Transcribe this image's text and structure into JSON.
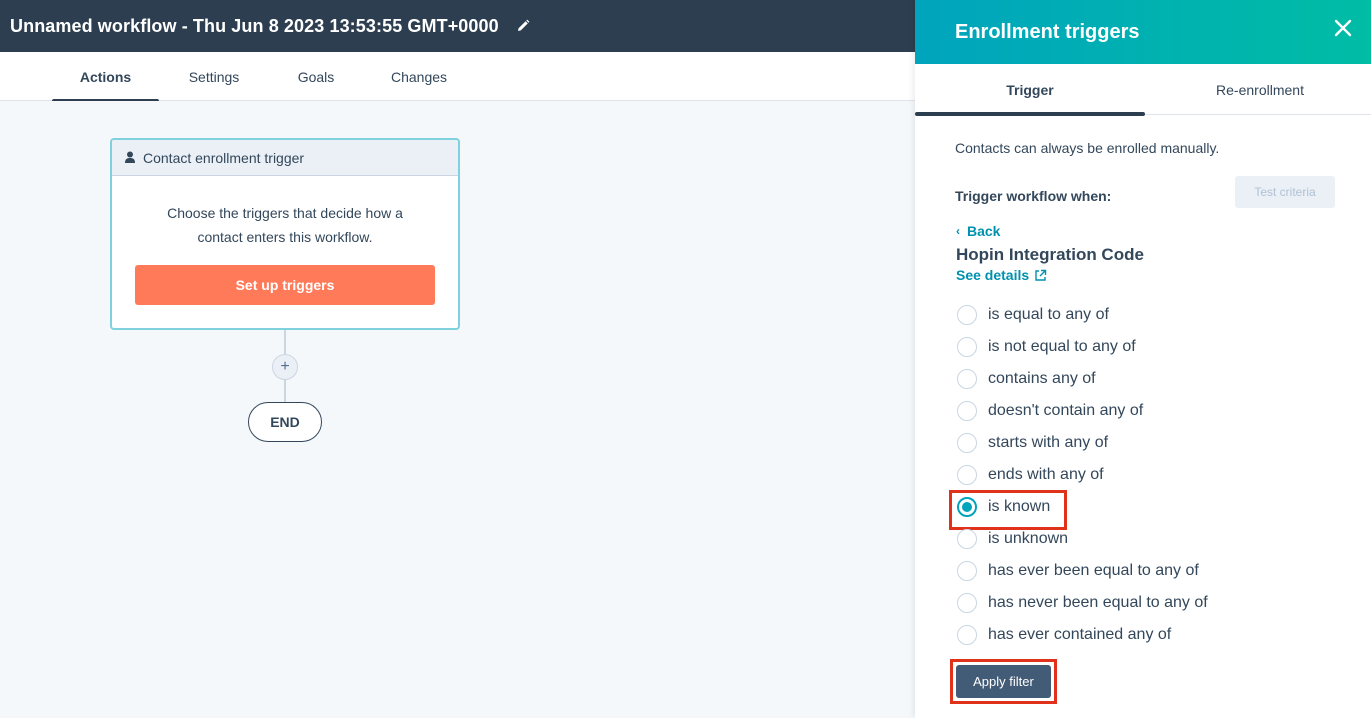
{
  "header": {
    "workflow_title": "Unnamed workflow - Thu Jun 8 2023 13:53:55 GMT+0000",
    "edit_icon": "pencil-icon"
  },
  "tabs": [
    {
      "label": "Actions",
      "active": true
    },
    {
      "label": "Settings",
      "active": false
    },
    {
      "label": "Goals",
      "active": false
    },
    {
      "label": "Changes",
      "active": false
    }
  ],
  "canvas": {
    "trigger_card": {
      "header_icon": "person-icon",
      "header": "Contact enrollment trigger",
      "body": "Choose the triggers that decide how a contact enters this workflow.",
      "button": "Set up triggers"
    },
    "add_action_symbol": "+",
    "end_label": "END"
  },
  "panel": {
    "title": "Enrollment triggers",
    "close_icon": "close-icon",
    "tabs": [
      {
        "label": "Trigger",
        "active": true
      },
      {
        "label": "Re-enrollment",
        "active": false
      }
    ],
    "manual_note": "Contacts can always be enrolled manually.",
    "trigger_when": "Trigger workflow when:",
    "test_criteria": "Test criteria",
    "back": "Back",
    "property_name": "Hopin Integration Code",
    "see_details": "See details",
    "options": [
      {
        "label": "is equal to any of",
        "selected": false
      },
      {
        "label": "is not equal to any of",
        "selected": false
      },
      {
        "label": "contains any of",
        "selected": false
      },
      {
        "label": "doesn't contain any of",
        "selected": false
      },
      {
        "label": "starts with any of",
        "selected": false
      },
      {
        "label": "ends with any of",
        "selected": false
      },
      {
        "label": "is known",
        "selected": true
      },
      {
        "label": "is unknown",
        "selected": false
      },
      {
        "label": "has ever been equal to any of",
        "selected": false
      },
      {
        "label": "has never been equal to any of",
        "selected": false
      },
      {
        "label": "has ever contained any of",
        "selected": false
      }
    ],
    "apply_button": "Apply filter"
  },
  "colors": {
    "topbar": "#2d3e50",
    "accent_teal": "#00a4bd",
    "cta_orange": "#ff7a59",
    "highlight_red": "#e0321b",
    "apply_button": "#425b76"
  }
}
